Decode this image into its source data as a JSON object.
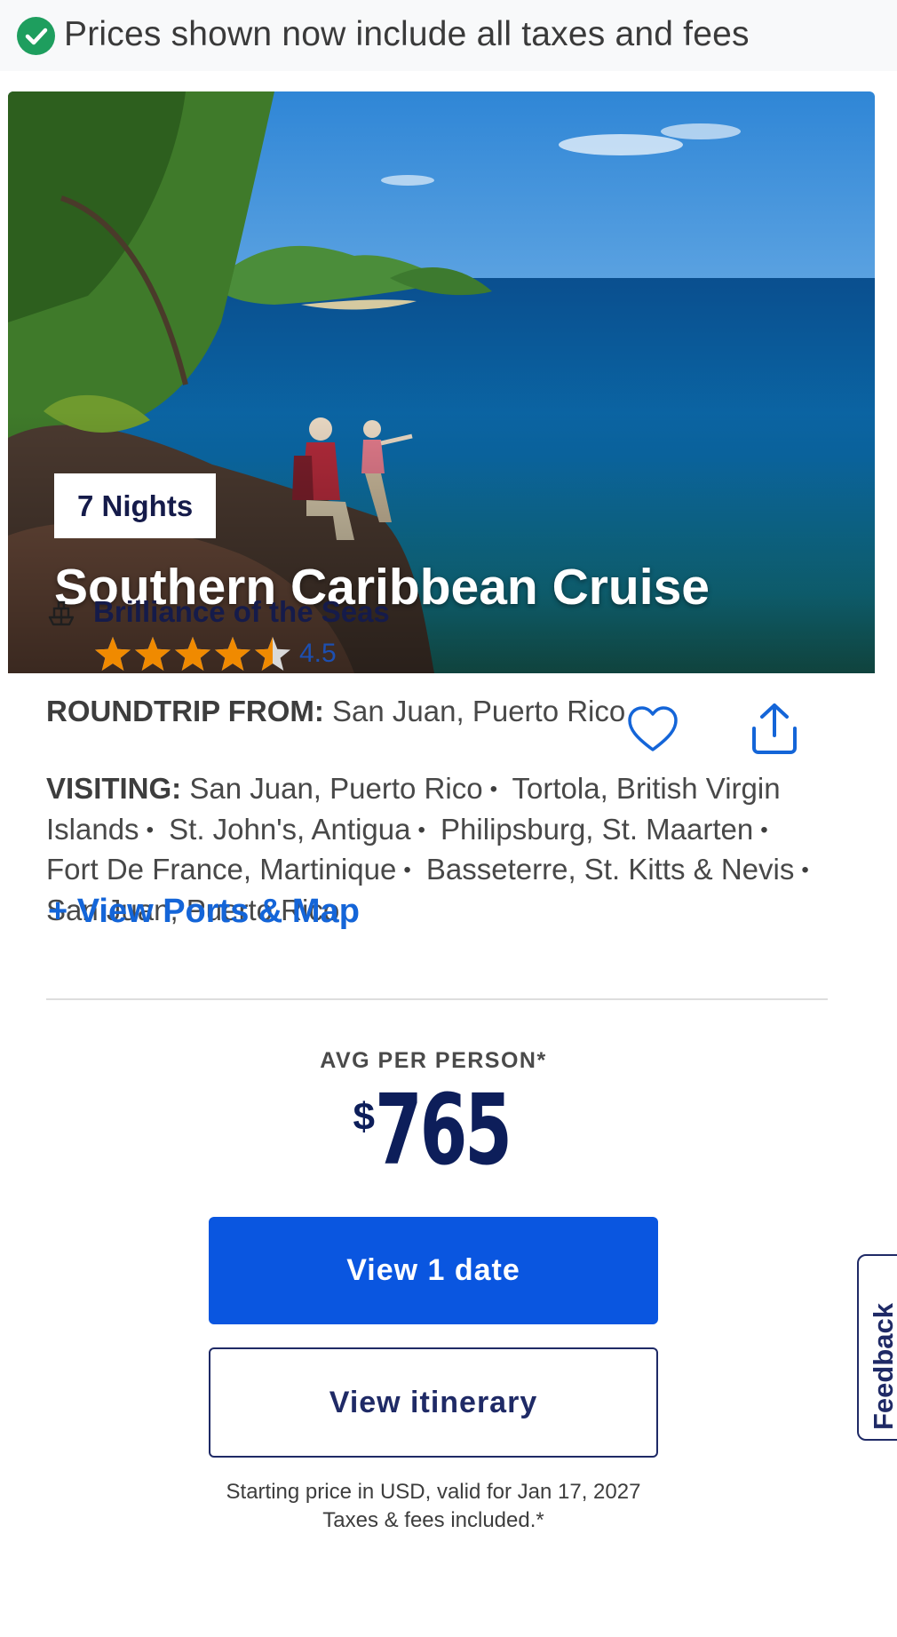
{
  "notice": {
    "text": "Prices shown now include all taxes and fees",
    "icon": "check-circle-icon"
  },
  "cruise": {
    "nights_badge": "7 Nights",
    "title": "Southern Caribbean Cruise",
    "ship_name": "Brilliance of the Seas",
    "rating_value": 4.5,
    "rating_text": "4.5",
    "rating_max": 5,
    "roundtrip_label": "ROUNDTRIP FROM:",
    "roundtrip_value": "San Juan, Puerto Rico",
    "visiting_label": "VISITING:",
    "ports": [
      "San Juan, Puerto Rico",
      "Tortola, British Virgin Islands",
      "St. John's, Antigua",
      "Philipsburg, St. Maarten",
      "Fort De France, Martinique",
      "Basseterre, St. Kitts & Nevis",
      "San Juan, Puerto Rico"
    ],
    "ports_link": "+ View Ports & Map"
  },
  "pricing": {
    "avg_label": "AVG PER PERSON*",
    "currency_symbol": "$",
    "amount": "765",
    "primary_button": "View 1 date",
    "secondary_button": "View itinerary",
    "footnote_line1": "Starting price in USD, valid for Jan 17, 2027",
    "footnote_line2": "Taxes & fees included.*"
  },
  "feedback_tab": "Feedback",
  "colors": {
    "brand_navy": "#151b4a",
    "link_blue": "#1465d8",
    "primary_button": "#0a56e0",
    "star": "#f08a00",
    "check": "#1e9e5e"
  }
}
